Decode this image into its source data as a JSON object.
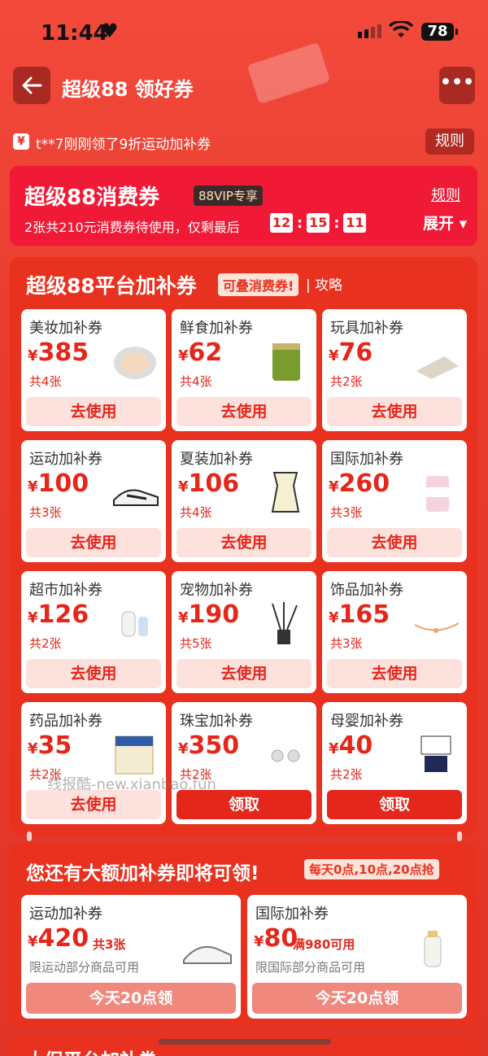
{
  "status": {
    "time": "11:44",
    "battery": "78"
  },
  "nav": {
    "title": "超级88 领好券",
    "more": "•••"
  },
  "ticker": {
    "icon": "¥",
    "text": "t**7刚刚领了9折运动加补券",
    "rules": "规则"
  },
  "vip": {
    "title": "超级88消费券",
    "badge": "88VIP专享",
    "rules": "规则",
    "subtitle": "2张共210元消费券待使用，仅剩最后",
    "timer": [
      "12",
      "15",
      "11"
    ],
    "expand": "展开 ▾"
  },
  "platform": {
    "title": "超级88平台加补券",
    "tag": "可叠消费券!",
    "link": "| 攻略",
    "cards": [
      {
        "name": "美妆加补券",
        "amount": "385",
        "count": "共4张",
        "button": "去使用",
        "icon": "cushion-compact-icon"
      },
      {
        "name": "鲜食加补券",
        "amount": "62",
        "count": "共4张",
        "button": "去使用",
        "icon": "tea-can-icon"
      },
      {
        "name": "玩具加补券",
        "amount": "76",
        "count": "共2张",
        "button": "去使用",
        "icon": "mat-toy-icon"
      },
      {
        "name": "运动加补券",
        "amount": "100",
        "count": "共3张",
        "button": "去使用",
        "icon": "sneaker-icon"
      },
      {
        "name": "夏装加补券",
        "amount": "106",
        "count": "共4张",
        "button": "去使用",
        "icon": "tank-top-icon"
      },
      {
        "name": "国际加补券",
        "amount": "260",
        "count": "共3张",
        "button": "去使用",
        "icon": "supplement-jar-icon"
      },
      {
        "name": "超市加补券",
        "amount": "126",
        "count": "共2张",
        "button": "去使用",
        "icon": "power-bank-icon"
      },
      {
        "name": "宠物加补券",
        "amount": "190",
        "count": "共5张",
        "button": "去使用",
        "icon": "reed-diffuser-icon"
      },
      {
        "name": "饰品加补券",
        "amount": "165",
        "count": "共3张",
        "button": "去使用",
        "icon": "bracelet-icon"
      },
      {
        "name": "药品加补券",
        "amount": "35",
        "count": "共2张",
        "button": "去使用",
        "icon": "medicine-box-icon"
      },
      {
        "name": "珠宝加补券",
        "amount": "350",
        "count": "共2张",
        "button": "领取",
        "icon": "pearl-earrings-icon"
      },
      {
        "name": "母婴加补券",
        "amount": "40",
        "count": "共2张",
        "button": "领取",
        "icon": "kids-outfit-icon"
      }
    ]
  },
  "upcoming": {
    "title": "您还有大额加补券即将可领!",
    "tag": "每天0点,10点,20点抢",
    "cards": [
      {
        "name": "运动加补券",
        "amount": "420",
        "extra": "共3张",
        "desc": "限运动部分商品可用",
        "button": "今天20点领",
        "icon": "running-shoe-icon"
      },
      {
        "name": "国际加补券",
        "amount": "80",
        "extra": "满980可用",
        "desc": "限国际部分商品可用",
        "button": "今天20点领",
        "icon": "baby-bottle-icon"
      }
    ]
  },
  "next_section": {
    "title": "大促平台加补券"
  },
  "watermark": "线报酷-new.xianbao.fun",
  "colors": {
    "accent": "#e4261b",
    "background": "#e93b2e",
    "vip_panel": "#f01a36"
  }
}
